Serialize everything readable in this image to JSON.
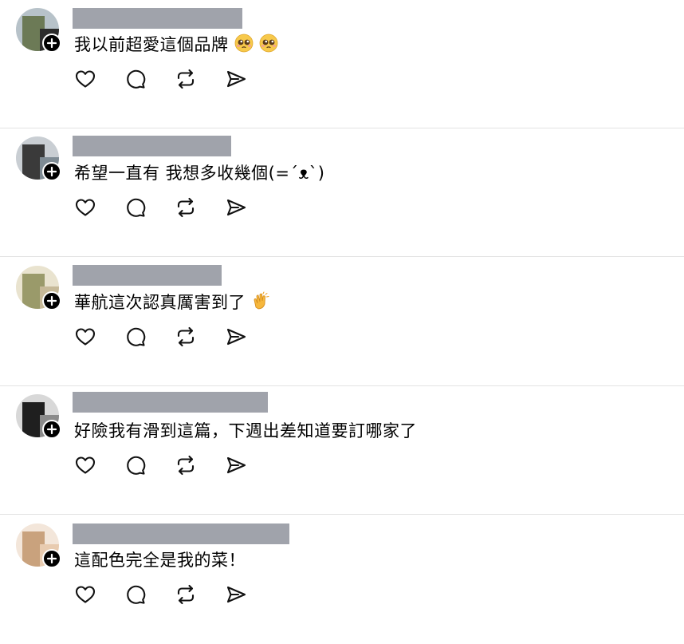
{
  "posts": [
    {
      "text": "我以前超愛這個品牌",
      "emoji": [
        "pleading-face",
        "pleading-face"
      ],
      "avatar_colors": [
        "#6c7a56",
        "#2b2b2b",
        "#b7c2c9"
      ]
    },
    {
      "text": "希望一直有 我想多收幾個(=´ᴥ`)",
      "emoji": [],
      "avatar_colors": [
        "#3a3a3a",
        "#7e8b94",
        "#c9ced3"
      ]
    },
    {
      "text": "華航這次認真厲害到了",
      "emoji": [
        "clapping-hands"
      ],
      "avatar_colors": [
        "#9a9a6a",
        "#c6b998",
        "#e9e3cf"
      ]
    },
    {
      "text": "好險我有滑到這篇，下週出差知道要訂哪家了",
      "emoji": [],
      "avatar_colors": [
        "#1f1f1f",
        "#8b8b8b",
        "#d8d8d8"
      ]
    },
    {
      "text": "這配色完全是我的菜！",
      "emoji": [],
      "avatar_colors": [
        "#c9a27d",
        "#e8cbb0",
        "#f3e6da"
      ]
    }
  ],
  "actions": {
    "like_icon": "heart-icon",
    "reply_icon": "comment-icon",
    "repost_icon": "repost-icon",
    "share_icon": "share-icon"
  },
  "colors": {
    "redaction": "#a0a3ab",
    "divider": "#e3e3e3"
  }
}
